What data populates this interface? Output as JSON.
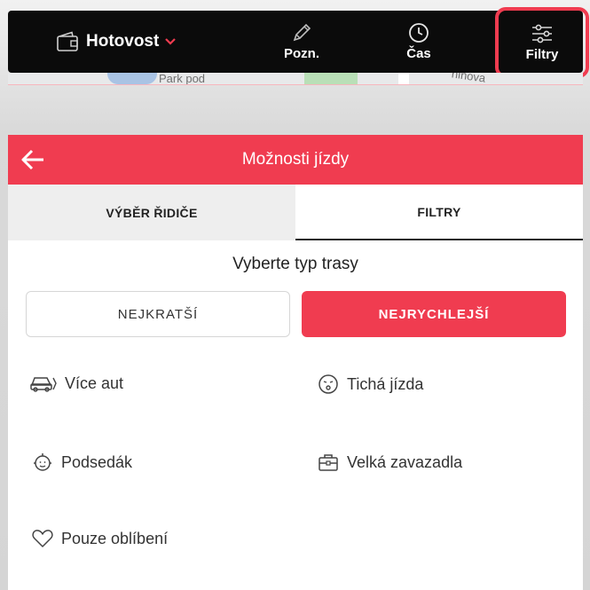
{
  "topbar": {
    "payment_label": "Hotovost",
    "note_label": "Pozn.",
    "time_label": "Čas",
    "filters_label": "Filtry"
  },
  "map": {
    "label_left": "Park pod",
    "label_right": "ninova"
  },
  "panel": {
    "title": "Možnosti jízdy",
    "tabs": [
      {
        "label": "VÝBĚR ŘIDIČE",
        "active": false
      },
      {
        "label": "FILTRY",
        "active": true
      }
    ],
    "route_title": "Vyberte typ trasy",
    "route_options": [
      {
        "label": "NEJKRATŠÍ",
        "selected": false
      },
      {
        "label": "NEJRYCHLEJŠÍ",
        "selected": true
      }
    ],
    "features": [
      {
        "label": "Více aut",
        "icon": "car-icon"
      },
      {
        "label": "Tichá jízda",
        "icon": "quiet-face-icon"
      },
      {
        "label": "Podsedák",
        "icon": "child-seat-icon"
      },
      {
        "label": "Velká zavazadla",
        "icon": "luggage-icon"
      },
      {
        "label": "Pouze oblíbení",
        "icon": "heart-icon"
      }
    ]
  },
  "colors": {
    "accent": "#f03c50",
    "topbar_bg": "#0b0b0b"
  }
}
